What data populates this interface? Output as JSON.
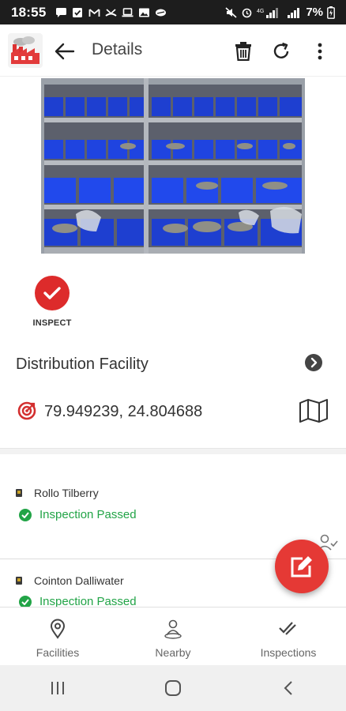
{
  "status_bar": {
    "time": "18:55",
    "network": "4G",
    "battery": "7%"
  },
  "app_bar": {
    "title": "Details",
    "logo_icon": "factory-logo-icon",
    "actions": [
      "trash-icon",
      "refresh-icon",
      "more-vert-icon"
    ]
  },
  "facility": {
    "status_label": "INSPECT",
    "name": "Distribution Facility",
    "coordinates": "79.949239, 24.804688"
  },
  "inspections": [
    {
      "inspector": "Rollo Tilberry",
      "result": "Inspection Passed"
    },
    {
      "inspector": "Cointon Dalliwater",
      "result": "Inspection Passed"
    }
  ],
  "bottom_nav": {
    "items": [
      {
        "label": "Facilities",
        "icon": "map-pin-icon"
      },
      {
        "label": "Nearby",
        "icon": "person-pin-icon"
      },
      {
        "label": "Inspections",
        "icon": "checkmarks-icon"
      }
    ]
  },
  "colors": {
    "accent": "#e53935",
    "success": "#22a447",
    "photo_bins": "#1f3cc9"
  }
}
